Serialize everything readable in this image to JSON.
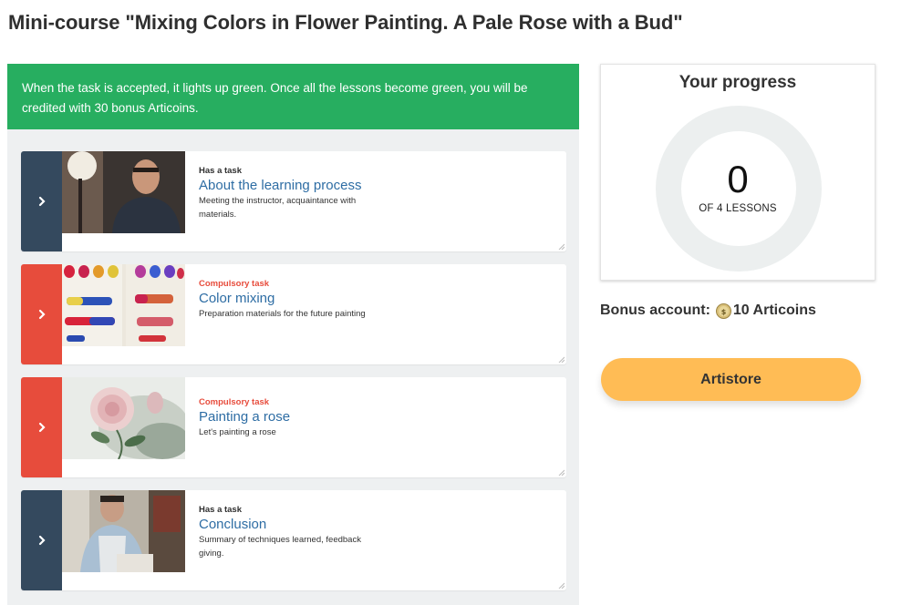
{
  "page": {
    "title": "Mini-course \"Mixing Colors in Flower Painting. A Pale Rose with a Bud\""
  },
  "notice": {
    "text": "When the task is accepted, it lights up green. Once all the lessons become green, you will be credited with 30 bonus Articoins."
  },
  "lessons": [
    {
      "status": "Has a task",
      "title": "About the learning process",
      "description": "Meeting the instructor, acquaintance with materials.",
      "tab_color": "#34495e",
      "status_color": "#2f2f2f",
      "icon": "chevron-right-icon"
    },
    {
      "status": "Compulsory task",
      "title": "Color mixing",
      "description": "Preparation materials for the future painting",
      "tab_color": "#e74c3c",
      "status_color": "#e74c3c",
      "icon": "chevron-right-icon"
    },
    {
      "status": "Compulsory task",
      "title": "Painting a rose",
      "description": "Let's painting a rose",
      "tab_color": "#e74c3c",
      "status_color": "#e74c3c",
      "icon": "chevron-right-icon"
    },
    {
      "status": "Has a task",
      "title": "Conclusion",
      "description": "Summary of techniques learned, feedback giving.",
      "tab_color": "#34495e",
      "status_color": "#2f2f2f",
      "icon": "chevron-right-icon"
    }
  ],
  "progress": {
    "title": "Your progress",
    "completed": "0",
    "label": "OF 4 LESSONS",
    "fraction": 0
  },
  "bonus": {
    "label": "Bonus account:",
    "amount": "10 Articoins",
    "icon": "coin-icon"
  },
  "artistore": {
    "label": "Artistore"
  },
  "colors": {
    "accent_green": "#27ae60",
    "dark_tab": "#34495e",
    "red_tab": "#e74c3c",
    "link_blue": "#2e6da4",
    "button_orange": "#ffbc55"
  }
}
